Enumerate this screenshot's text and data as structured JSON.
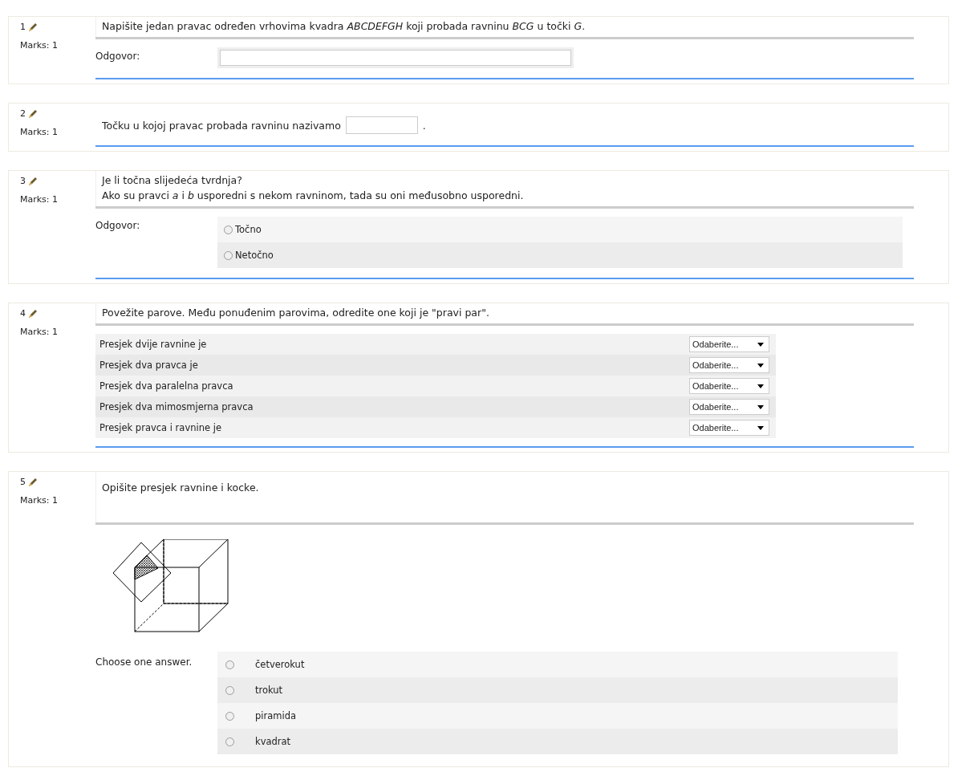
{
  "questions": [
    {
      "number": "1",
      "marks": "Marks: 1",
      "kind": "shortanswer",
      "text": "Napišite jedan pravac određen vrhovima kvadra *ABCDEFGH* koji probada ravninu *BCG* u točki *G*.",
      "answer_label": "Odgovor:"
    },
    {
      "number": "2",
      "marks": "Marks: 1",
      "kind": "inline",
      "text_before": "Točku u kojoj pravac probada ravninu nazivamo",
      "text_after": "."
    },
    {
      "number": "3",
      "marks": "Marks: 1",
      "kind": "truefalse",
      "text": "Je li točna slijedeća tvrdnja?",
      "text_2": "Ako su pravci *a* i *b* usporedni s nekom ravninom, tada su oni međusobno usporedni.",
      "answer_label": "Odgovor:",
      "options": [
        {
          "label": "Točno",
          "selected": false
        },
        {
          "label": "Netočno",
          "selected": false
        }
      ]
    },
    {
      "number": "4",
      "marks": "Marks: 1",
      "kind": "match",
      "text": "Povežite parove. Među ponuđenim parovima, odredite one koji je \"pravi par\".",
      "pairs": [
        {
          "stem": "Presjek dvije ravnine je",
          "choice": "Odaberite..."
        },
        {
          "stem": "Presjek dva pravca je",
          "choice": "Odaberite..."
        },
        {
          "stem": "Presjek dva paralelna pravca",
          "choice": "Odaberite..."
        },
        {
          "stem": "Presjek dva mimosmjerna pravca",
          "choice": "Odaberite..."
        },
        {
          "stem": "Presjek pravca i ravnine je",
          "choice": "Odaberite..."
        }
      ]
    },
    {
      "number": "5",
      "marks": "Marks: 1",
      "kind": "multichoice",
      "text": "Opišite presjek ravnine i kocke.",
      "answer_label": "Choose one answer.",
      "options": [
        {
          "label": "četverokut",
          "selected": false
        },
        {
          "label": "trokut",
          "selected": false
        },
        {
          "label": "piramida",
          "selected": false
        },
        {
          "label": "kvadrat",
          "selected": false
        }
      ]
    }
  ]
}
